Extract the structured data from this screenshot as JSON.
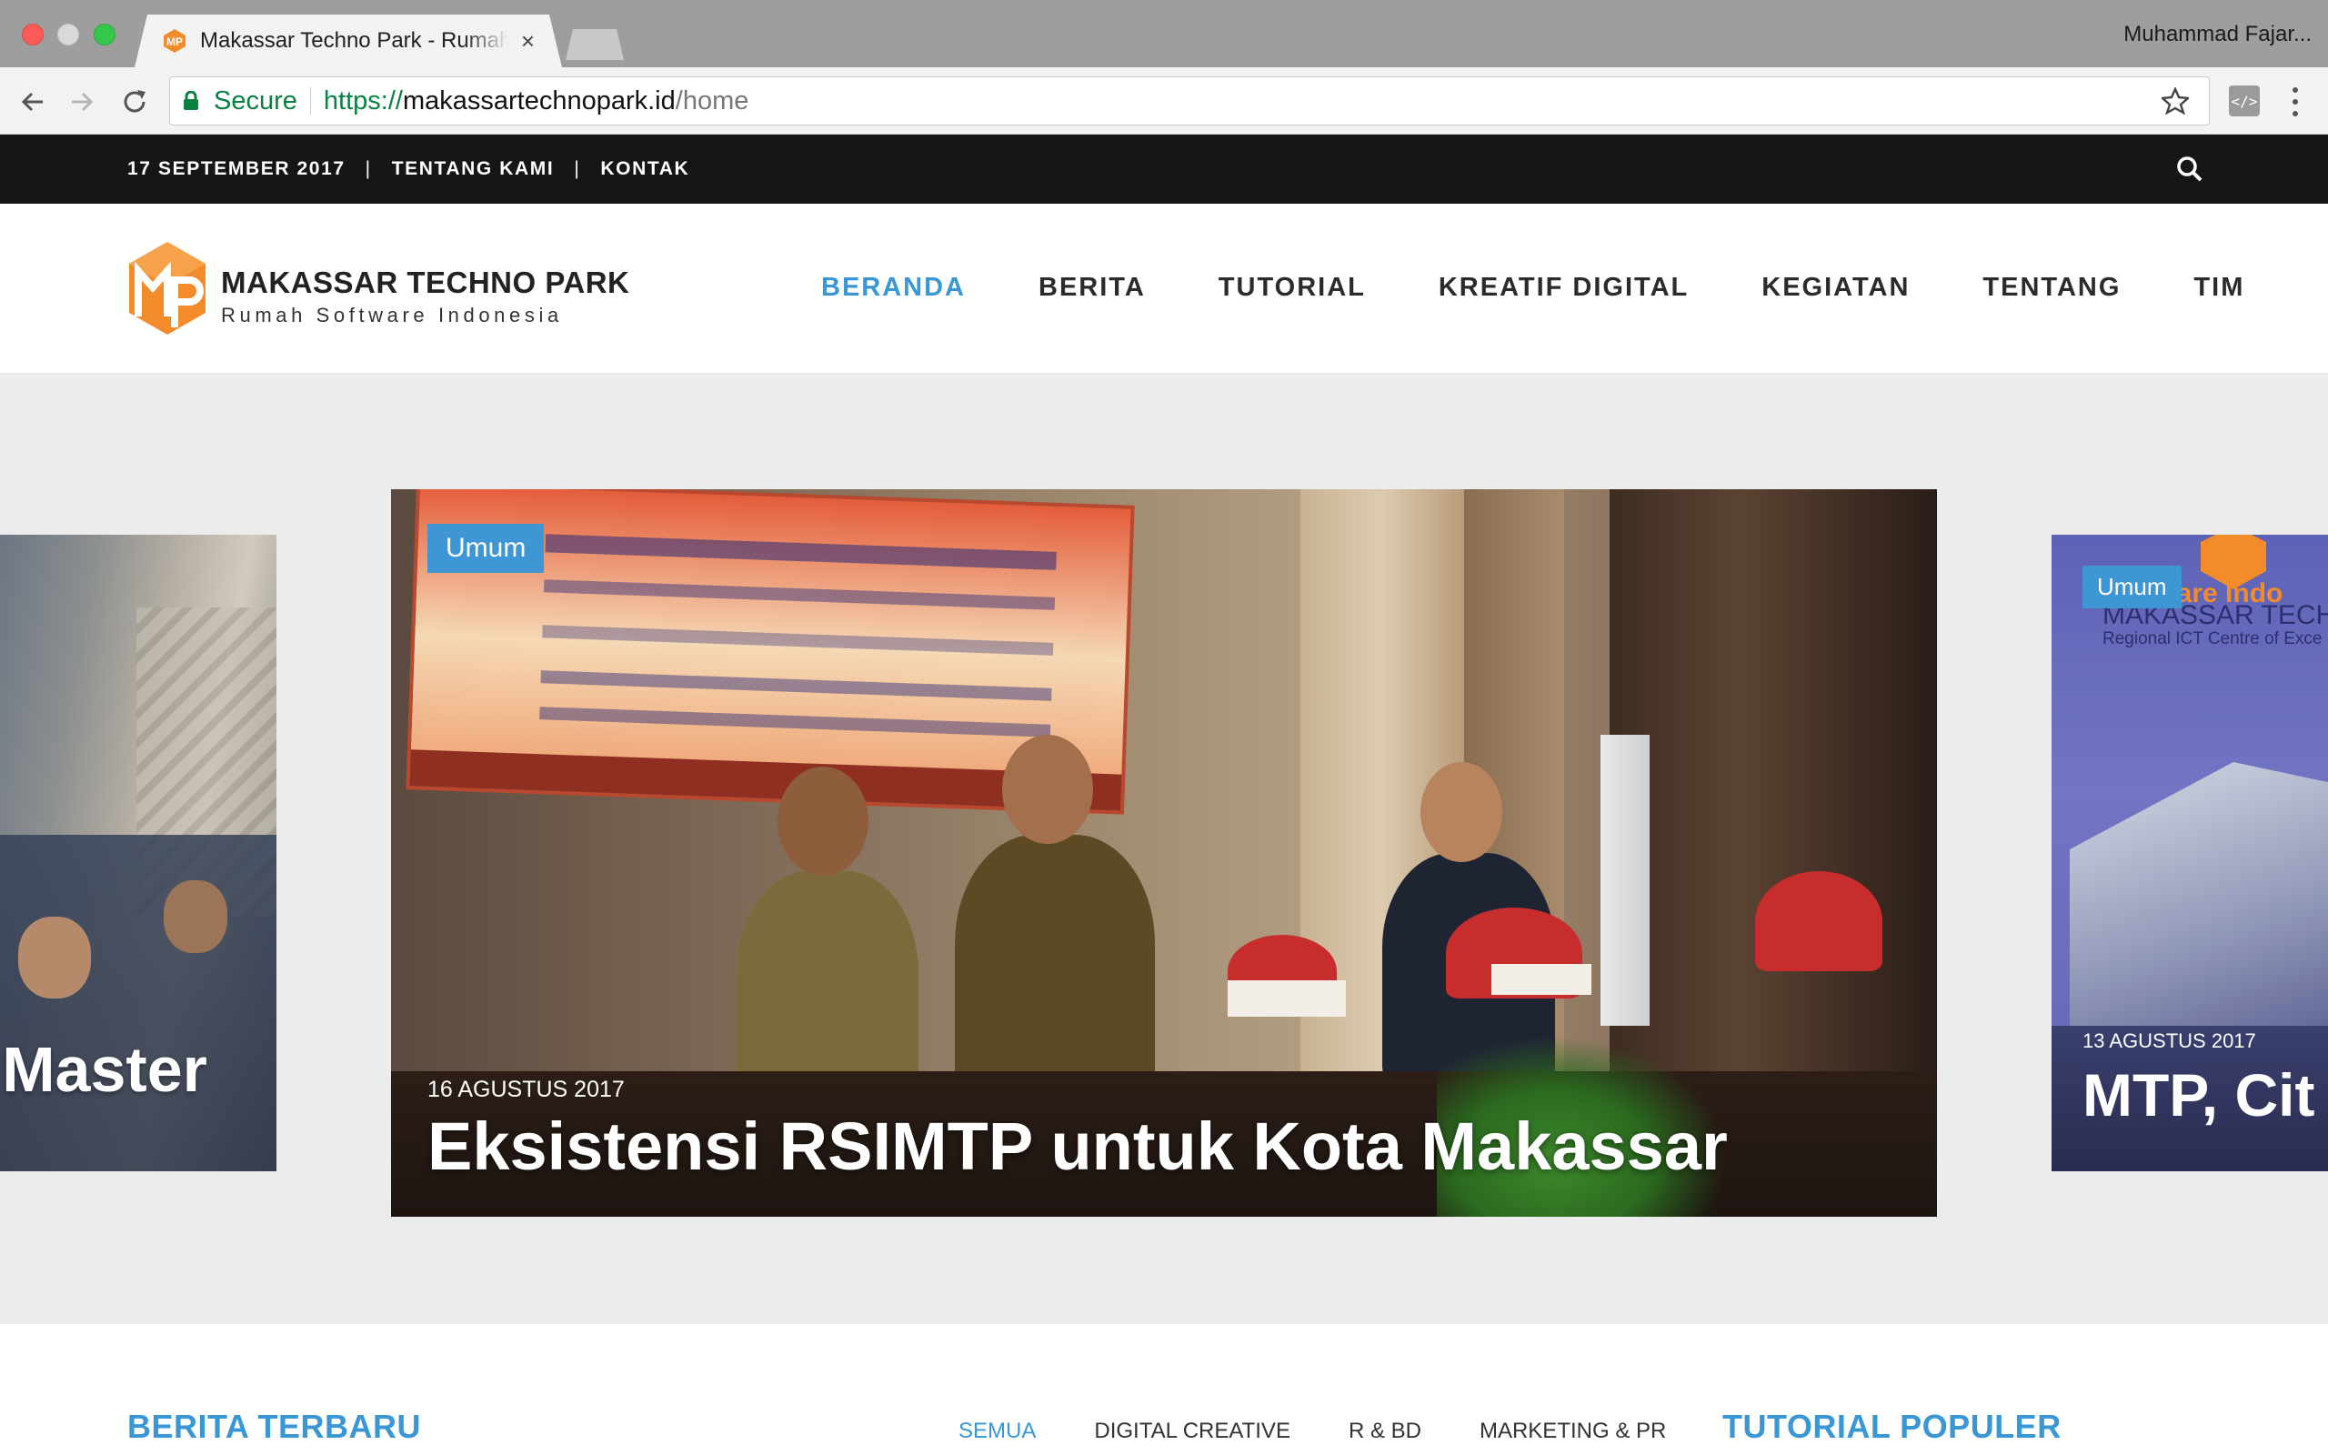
{
  "browser": {
    "tab_title": "Makassar Techno Park - Rumah Software Indonesia",
    "tab_close": "×",
    "profile_name": "Muhammad Fajar...",
    "secure_label": "Secure",
    "url_protocol": "https://",
    "url_host": "makassartechnopark.id",
    "url_path": "/home",
    "ext_label": "</>"
  },
  "topbar": {
    "date": "17 SEPTEMBER 2017",
    "separator": "|",
    "links": [
      "TENTANG KAMI",
      "KONTAK"
    ]
  },
  "logo": {
    "name": "MAKASSAR TECHNO PARK",
    "tagline": "Rumah Software Indonesia",
    "mark_color": "#f28b2a"
  },
  "nav": {
    "items": [
      "BERANDA",
      "BERITA",
      "TUTORIAL",
      "KREATIF DIGITAL",
      "KEGIATAN",
      "TENTANG",
      "TIM"
    ],
    "active": "BERANDA",
    "accent": "#3a97d6"
  },
  "slider": {
    "left": {
      "title": "T Master"
    },
    "main": {
      "category": "Umum",
      "date": "16 AGUSTUS 2017",
      "title": "Eksistensi RSIMTP untuk Kota Makassar"
    },
    "right": {
      "category": "Umum",
      "date": "13 AGUSTUS 2017",
      "title": "MTP, Cit",
      "banner_line1": "Software Indo",
      "banner_line2": "MAKASSAR TECHNOF",
      "banner_line3": "Regional ICT Centre of Exce"
    }
  },
  "bottom": {
    "news_title": "BERITA TERBARU",
    "tabs": [
      "SEMUA",
      "DIGITAL CREATIVE",
      "R & BD",
      "MARKETING & PR"
    ],
    "active_tab": "SEMUA",
    "tutorial_title": "TUTORIAL POPULER"
  }
}
